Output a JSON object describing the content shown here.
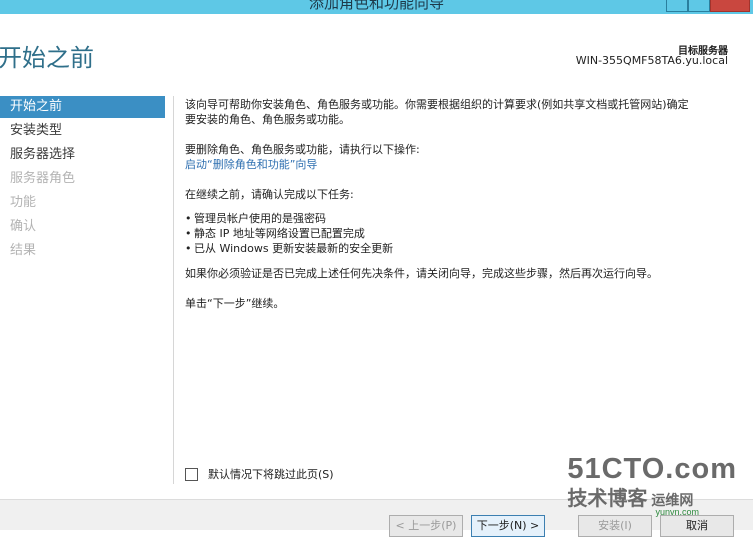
{
  "window": {
    "title": "添加角色和功能向导"
  },
  "header": {
    "title": "开始之前",
    "server_label": "目标服务器",
    "server_name": "WIN-355QMF58TA6.yu.local"
  },
  "sidebar": {
    "items": [
      {
        "label": "开始之前",
        "state": "active"
      },
      {
        "label": "安装类型",
        "state": "enabled"
      },
      {
        "label": "服务器选择",
        "state": "enabled"
      },
      {
        "label": "服务器角色",
        "state": "disabled"
      },
      {
        "label": "功能",
        "state": "disabled"
      },
      {
        "label": "确认",
        "state": "disabled"
      },
      {
        "label": "结果",
        "state": "disabled"
      }
    ]
  },
  "content": {
    "intro_line1": "该向导可帮助你安装角色、角色服务或功能。你需要根据组织的计算要求(例如共享文档或托管网站)确定",
    "intro_line2": "要安装的角色、角色服务或功能。",
    "remove_text": "要删除角色、角色服务或功能，请执行以下操作:",
    "remove_link": "启动“删除角色和功能”向导",
    "before_text": "在继续之前，请确认完成以下任务:",
    "tasks": [
      "管理员帐户使用的是强密码",
      "静态 IP 地址等网络设置已配置完成",
      "已从 Windows 更新安装最新的安全更新"
    ],
    "verify_text": "如果你必须验证是否已完成上述任何先决条件，请关闭向导，完成这些步骤，然后再次运行向导。",
    "continue_text": "单击“下一步”继续。"
  },
  "skip_checkbox": {
    "label": "默认情况下将跳过此页(S)",
    "checked": false
  },
  "footer": {
    "prev_label": "< 上一步(P)",
    "next_label": "下一步(N) >",
    "install_label": "安装(I)",
    "cancel_label": "取消"
  },
  "watermark": {
    "line1": "51CTO.com",
    "line2": "技术博客",
    "url": "yunvn.com",
    "overlay": "运维网"
  },
  "colors": {
    "titlebar": "#5ec8e6",
    "accent": "#3b8fc4",
    "header_text": "#2f6f8a",
    "link": "#2e6fb0"
  }
}
